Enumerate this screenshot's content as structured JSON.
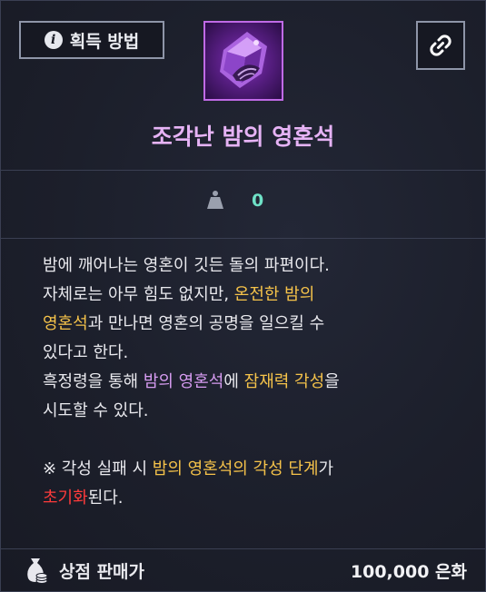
{
  "header": {
    "acquire_label": "획득 방법",
    "item_name": "조각난 밤의 영혼석",
    "icons": {
      "info": "info-icon",
      "link": "link-icon",
      "item": "night-soulstone-fragment-icon"
    }
  },
  "stats": {
    "weight_icon": "weight-icon",
    "weight_value": "0"
  },
  "description": {
    "line1": "밤에 깨어나는 영혼이 깃든 돌의 파편이다.",
    "line2a": "자체로는 아무 힘도 없지만, ",
    "line2b": "온전한 밤의",
    "line3a": "영혼석",
    "line3b": "과 만나면 영혼의 공명을 일으킬 수",
    "line4": "있다고 한다.",
    "line5a": "흑정령을 통해 ",
    "line5b": "밤의 영혼석",
    "line5c": "에 ",
    "line5d": "잠재력 각성",
    "line5e": "을",
    "line6": "시도할 수 있다.",
    "note1a": "※ 각성 실패 시 ",
    "note1b": "밤의 영혼석의 각성 단계",
    "note1c": "가",
    "note2a": "초기화",
    "note2b": "된다."
  },
  "colors": {
    "title": "#e6b3f5",
    "highlight_yellow": "#f6c34a",
    "highlight_purple": "#d79cf2",
    "highlight_red": "#ff3b3b",
    "weight_value": "#6fe1c7"
  },
  "footer": {
    "sell_label": "상점 판매가",
    "sell_price": "100,000 은화",
    "bag_icon": "money-bag-icon"
  }
}
